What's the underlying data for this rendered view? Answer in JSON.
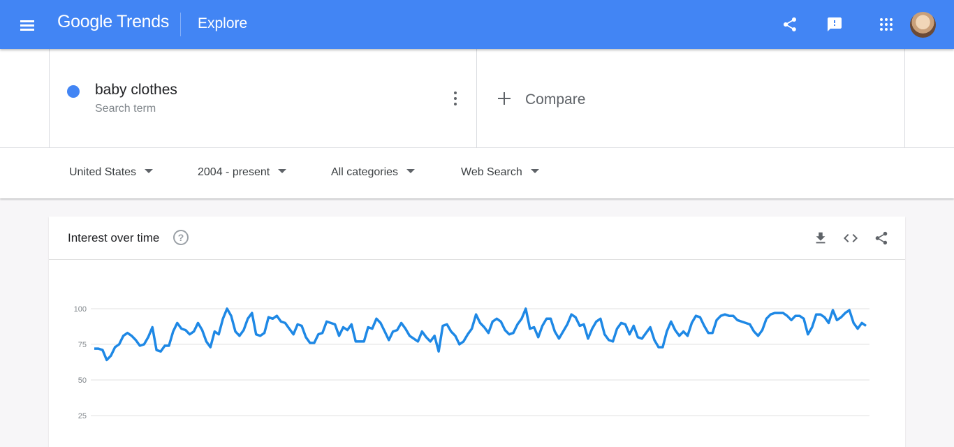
{
  "header": {
    "logo_text": "Google Trends",
    "page_title": "Explore",
    "icons": [
      "menu-icon",
      "share-icon",
      "feedback-icon",
      "apps-icon",
      "avatar"
    ]
  },
  "search": {
    "term": "baby clothes",
    "term_type": "Search term",
    "term_color": "#4285f4",
    "compare_label": "Compare"
  },
  "filters": {
    "region": "United States",
    "time_range": "2004 - present",
    "category": "All categories",
    "search_type": "Web Search"
  },
  "card": {
    "title": "Interest over time",
    "icons": [
      "help-icon",
      "download-icon",
      "embed-icon",
      "share-icon"
    ]
  },
  "colors": {
    "accent": "#4285f4",
    "series_line": "#1e88e5"
  },
  "chart_data": {
    "type": "line",
    "title": "Interest over time",
    "ylim": [
      0,
      100
    ],
    "y_ticks": [
      {
        "value": 100,
        "label": "100"
      },
      {
        "value": 75,
        "label": "75"
      },
      {
        "value": 50,
        "label": "50"
      },
      {
        "value": 25,
        "label": "25"
      }
    ],
    "grid": true,
    "series": [
      {
        "name": "baby clothes",
        "values": [
          72,
          72,
          71,
          64,
          67,
          73,
          75,
          81,
          83,
          81,
          78,
          74,
          75,
          80,
          87,
          71,
          70,
          74,
          74,
          84,
          90,
          86,
          85,
          82,
          84,
          90,
          85,
          77,
          73,
          84,
          82,
          93,
          100,
          95,
          84,
          81,
          85,
          93,
          97,
          82,
          81,
          83,
          94,
          93,
          95,
          91,
          90,
          86,
          82,
          89,
          88,
          80,
          76,
          76,
          82,
          83,
          91,
          90,
          89,
          81,
          87,
          85,
          89,
          77,
          77,
          77,
          87,
          86,
          93,
          90,
          84,
          78,
          84,
          85,
          90,
          86,
          81,
          79,
          77,
          84,
          80,
          77,
          81,
          70,
          88,
          89,
          84,
          81,
          75,
          77,
          82,
          86,
          96,
          90,
          87,
          83,
          91,
          93,
          91,
          85,
          82,
          83,
          89,
          93,
          100,
          86,
          87,
          80,
          88,
          93,
          93,
          84,
          79,
          84,
          89,
          96,
          94,
          88,
          89,
          79,
          86,
          91,
          93,
          82,
          78,
          77,
          86,
          90,
          89,
          82,
          88,
          80,
          79,
          83,
          87,
          78,
          73,
          73,
          84,
          91,
          85,
          81,
          84,
          81,
          90,
          95,
          94,
          88,
          83,
          83,
          92,
          95,
          96,
          95,
          95,
          92,
          91,
          90,
          89,
          84,
          81,
          85,
          93,
          96,
          97,
          97,
          97,
          95,
          92,
          95,
          95,
          93,
          82,
          87,
          96,
          96,
          94,
          90,
          99,
          92,
          94,
          97,
          99,
          90,
          86,
          90,
          88
        ]
      }
    ]
  }
}
